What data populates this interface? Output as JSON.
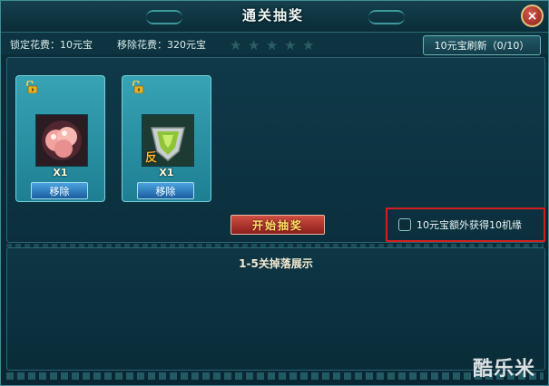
{
  "window": {
    "title": "通关抽奖",
    "close_label": "×"
  },
  "costs": {
    "lock_cost": "锁定花费：10元宝",
    "remove_cost": "移除花费：320元宝",
    "stars": [
      "★",
      "★",
      "★",
      "★",
      "★"
    ]
  },
  "refresh_button": "10元宝刷新（0/10）",
  "cards": [
    {
      "item_icon": "pink-pearls-icon",
      "quantity": "X1",
      "remove_label": "移除",
      "lock_icon": "open-lock-icon"
    },
    {
      "item_icon": "green-gem-shield-icon",
      "item_badge": "反",
      "quantity": "X1",
      "remove_label": "移除",
      "lock_icon": "open-lock-icon"
    }
  ],
  "start_button": "开始抽奖",
  "extra_option": {
    "label": "10元宝额外获得10机缘",
    "checked": false
  },
  "drop_display": {
    "title": "1-5关掉落展示"
  },
  "watermark": "酷乐米",
  "colors": {
    "highlight_border": "#d11f1f",
    "card_bg": "#2a93a6",
    "start_button": "#b9342e"
  }
}
